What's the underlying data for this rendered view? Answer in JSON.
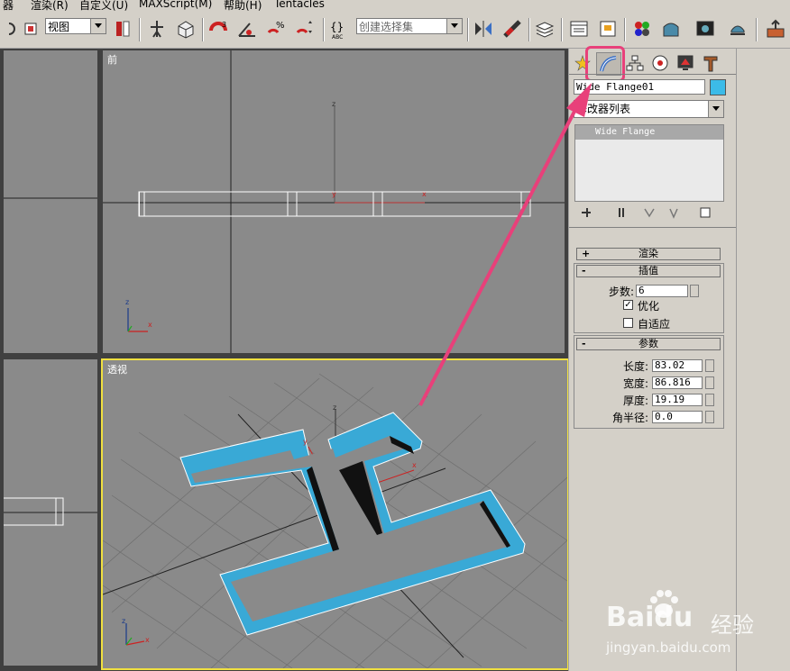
{
  "menubar": {
    "items": [
      "器",
      "渲染(R)",
      "自定义(U)",
      "MAXScript(M)",
      "帮助(H)",
      "Tentacles"
    ]
  },
  "toolbar": {
    "view_combo": "视图",
    "selection_set_placeholder": "创建选择集",
    "abc_label": "ABC"
  },
  "viewports": {
    "front_label": "前",
    "persp_label": "透视",
    "axis_x": "x",
    "axis_y": "y",
    "axis_z": "z"
  },
  "panel": {
    "object_name": "Wide Flange01",
    "object_color": "#3cbbe8",
    "modifier_list_label": "修改器列表",
    "stack_item": "Wide Flange",
    "render_rollout": "渲染",
    "interp_rollout": "插值",
    "steps_label": "步数:",
    "steps_value": "6",
    "optimize_label": "优化",
    "optimize_checked": true,
    "adaptive_label": "自适应",
    "adaptive_checked": false,
    "params_rollout": "参数",
    "length_label": "长度:",
    "length_value": "83.02",
    "width_label": "宽度:",
    "width_value": "86.816",
    "thickness_label": "厚度:",
    "thickness_value": "19.19",
    "corner_label": "角半径:",
    "corner_value": "0.0",
    "plus_sign": "+",
    "minus_sign": "-"
  },
  "watermark": {
    "brand": "Baidu",
    "jingyan": "经验",
    "url": "jingyan.baidu.com"
  },
  "colors": {
    "highlight": "#e8407a",
    "active_viewport": "#f0e040",
    "shape_cyan": "#39a9d6"
  }
}
